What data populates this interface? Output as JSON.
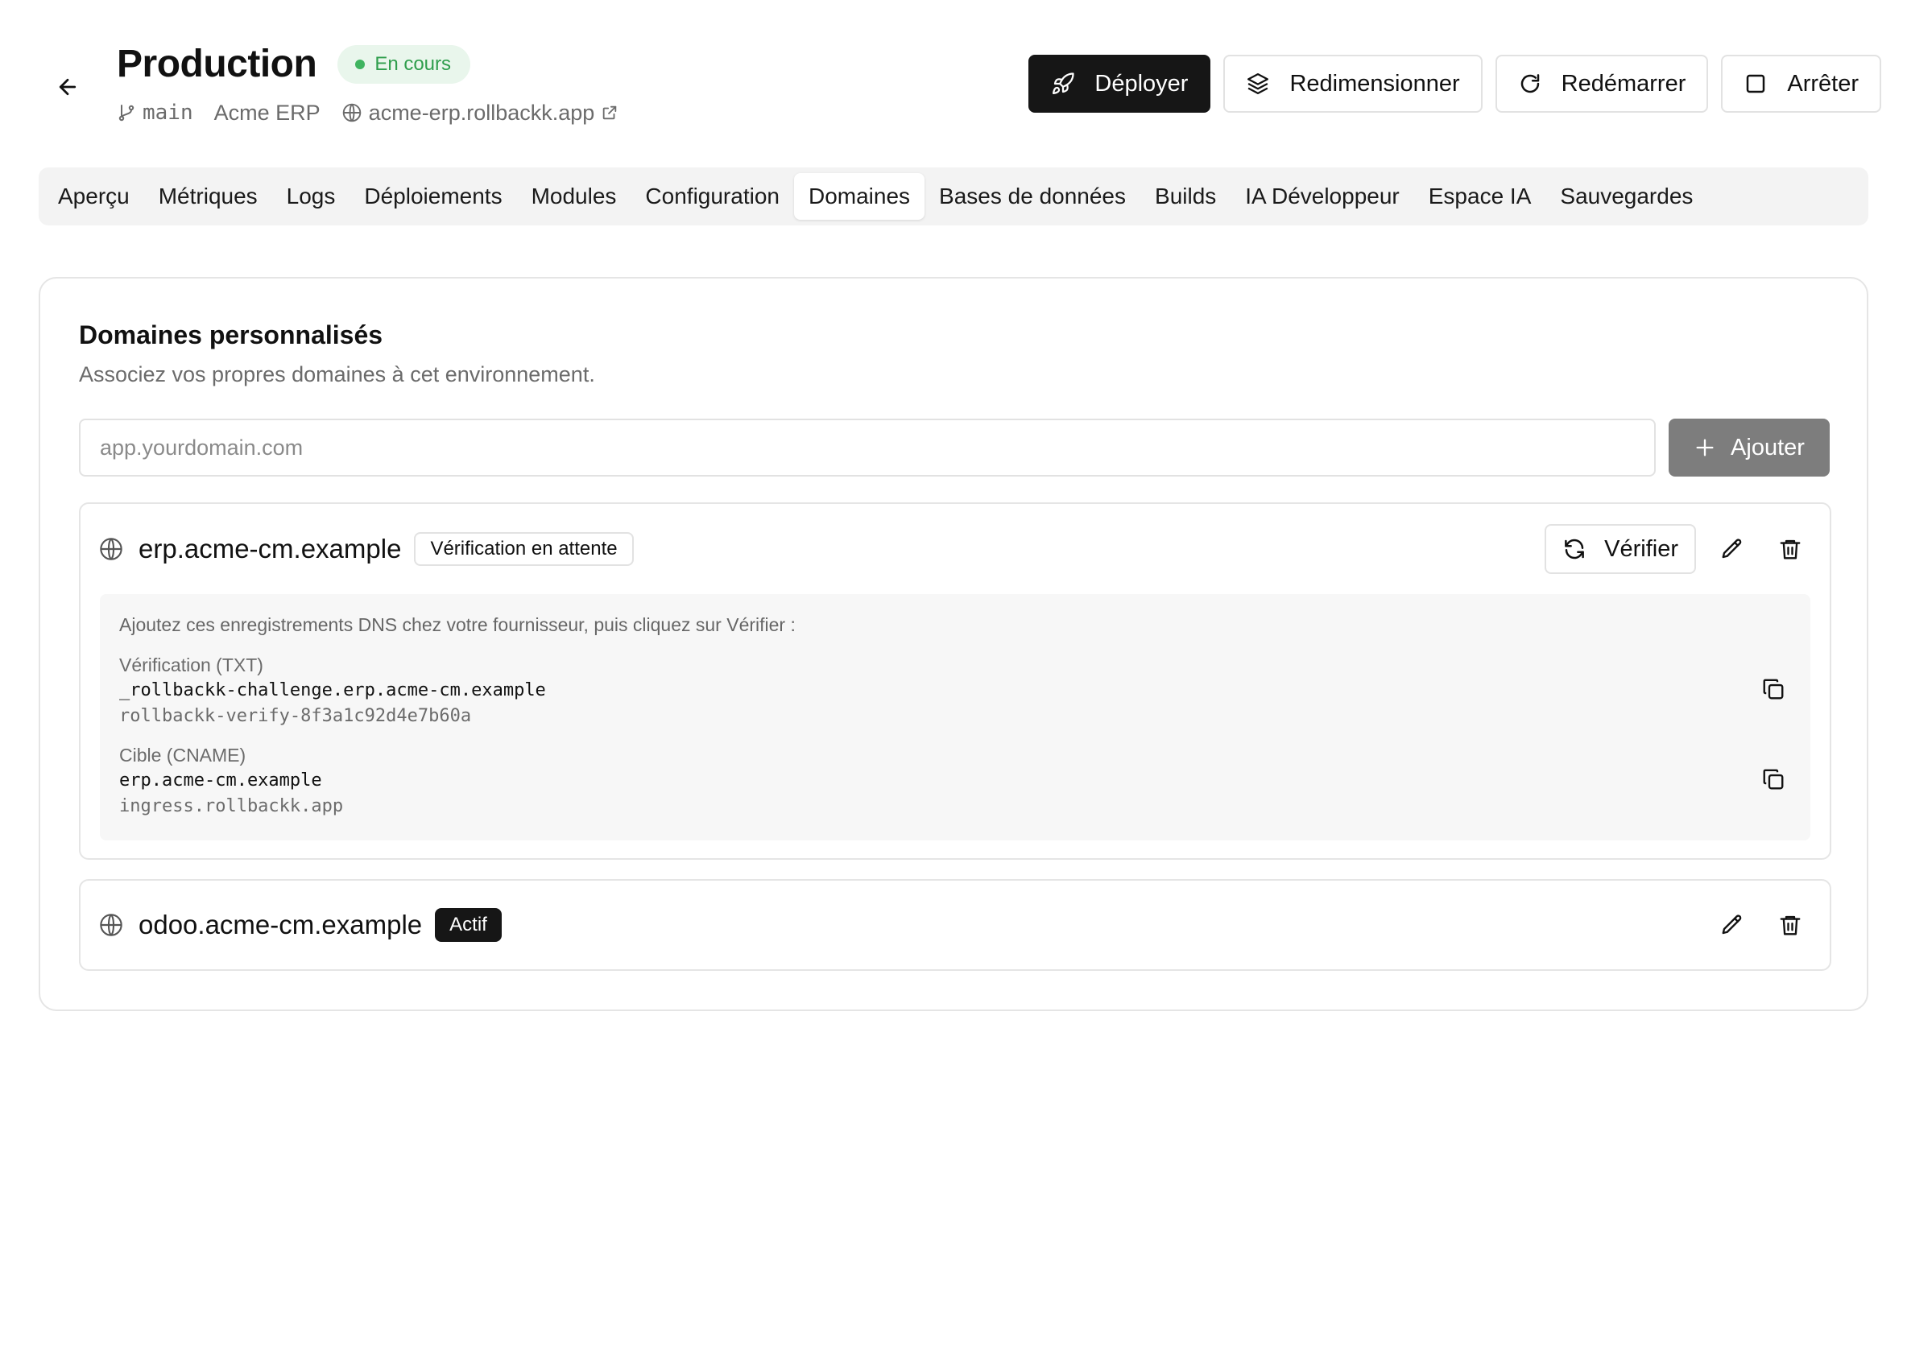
{
  "header": {
    "title": "Production",
    "status": "En cours",
    "branch": "main",
    "project": "Acme ERP",
    "url": "acme-erp.rollbackk.app",
    "status_color": "#2f9e4d"
  },
  "actions": {
    "deploy": "Déployer",
    "resize": "Redimensionner",
    "restart": "Redémarrer",
    "stop": "Arrêter"
  },
  "tabs": [
    {
      "label": "Aperçu"
    },
    {
      "label": "Métriques"
    },
    {
      "label": "Logs"
    },
    {
      "label": "Déploiements"
    },
    {
      "label": "Modules"
    },
    {
      "label": "Configuration"
    },
    {
      "label": "Domaines",
      "active": true
    },
    {
      "label": "Bases de données"
    },
    {
      "label": "Builds"
    },
    {
      "label": "IA Développeur"
    },
    {
      "label": "Espace IA"
    },
    {
      "label": "Sauvegardes"
    }
  ],
  "domains_card": {
    "title": "Domaines personnalisés",
    "subtitle": "Associez vos propres domaines à cet environnement.",
    "input_placeholder": "app.yourdomain.com",
    "add_label": "Ajouter"
  },
  "domains": [
    {
      "name": "erp.acme-cm.example",
      "status": "Vérification en attente",
      "verify_label": "Vérifier",
      "dns_intro": "Ajoutez ces enregistrements DNS chez votre fournisseur, puis cliquez sur Vérifier :",
      "records": [
        {
          "label": "Vérification (TXT)",
          "name": "_rollbackk-challenge.erp.acme-cm.example",
          "value": "rollbackk-verify-8f3a1c92d4e7b60a"
        },
        {
          "label": "Cible (CNAME)",
          "name": "erp.acme-cm.example",
          "value": "ingress.rollbackk.app"
        }
      ]
    },
    {
      "name": "odoo.acme-cm.example",
      "status": "Actif"
    }
  ],
  "icons": [
    "arrow-left-icon",
    "git-branch-icon",
    "globe-icon",
    "external-link-icon",
    "rocket-icon",
    "layers-icon",
    "rotate-cw-icon",
    "square-icon",
    "plus-icon",
    "refresh-icon",
    "pencil-icon",
    "trash-icon",
    "copy-icon"
  ]
}
